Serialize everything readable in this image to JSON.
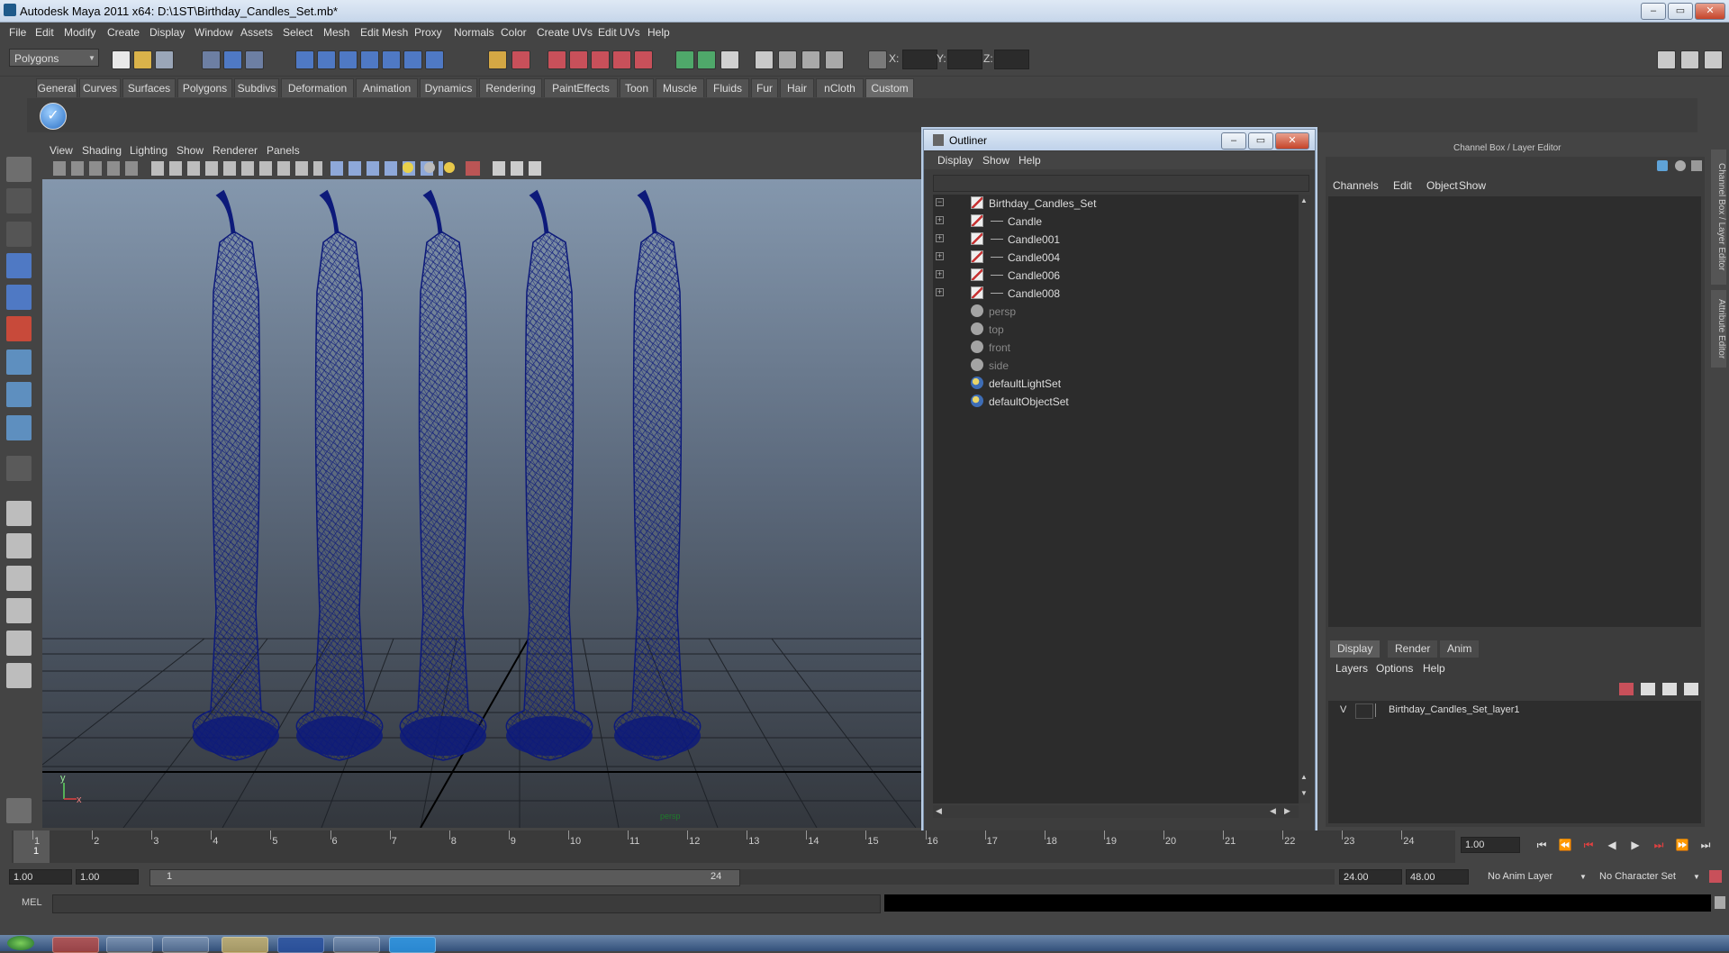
{
  "window": {
    "title": "Autodesk Maya 2011 x64: D:\\1ST\\Birthday_Candles_Set.mb*",
    "min": "‒",
    "max": "▭",
    "close": "✕"
  },
  "menus": [
    "File",
    "Edit",
    "Modify",
    "Create",
    "Display",
    "Window",
    "Assets",
    "Select",
    "Mesh",
    "Edit Mesh",
    "Proxy",
    "Normals",
    "Color",
    "Create UVs",
    "Edit UVs",
    "Help"
  ],
  "statusline": {
    "mode": "Polygons",
    "x_label": "X:",
    "y_label": "Y:",
    "z_label": "Z:"
  },
  "shelf_tabs": [
    "General",
    "Curves",
    "Surfaces",
    "Polygons",
    "Subdivs",
    "Deformation",
    "Animation",
    "Dynamics",
    "Rendering",
    "PaintEffects",
    "Toon",
    "Muscle",
    "Fluids",
    "Fur",
    "Hair",
    "nCloth",
    "Custom"
  ],
  "shelf_active": "Custom",
  "viewport": {
    "menus": [
      "View",
      "Shading",
      "Lighting",
      "Show",
      "Renderer",
      "Panels"
    ],
    "axis_y": "y",
    "axis_x": "x",
    "camera_label": "persp"
  },
  "outliner": {
    "title": "Outliner",
    "menus": [
      "Display",
      "Show",
      "Help"
    ],
    "items": [
      {
        "label": "Birthday_Candles_Set",
        "type": "mesh",
        "expand": "−",
        "indent": 0,
        "dim": false
      },
      {
        "label": "Candle",
        "type": "mesh",
        "expand": "+",
        "indent": 1,
        "dim": false
      },
      {
        "label": "Candle001",
        "type": "mesh",
        "expand": "+",
        "indent": 1,
        "dim": false
      },
      {
        "label": "Candle004",
        "type": "mesh",
        "expand": "+",
        "indent": 1,
        "dim": false
      },
      {
        "label": "Candle006",
        "type": "mesh",
        "expand": "+",
        "indent": 1,
        "dim": false
      },
      {
        "label": "Candle008",
        "type": "mesh",
        "expand": "+",
        "indent": 1,
        "dim": false
      },
      {
        "label": "persp",
        "type": "cam",
        "expand": "",
        "indent": 0,
        "dim": true
      },
      {
        "label": "top",
        "type": "cam",
        "expand": "",
        "indent": 0,
        "dim": true
      },
      {
        "label": "front",
        "type": "cam",
        "expand": "",
        "indent": 0,
        "dim": true
      },
      {
        "label": "side",
        "type": "cam",
        "expand": "",
        "indent": 0,
        "dim": true
      },
      {
        "label": "defaultLightSet",
        "type": "set",
        "expand": "",
        "indent": 0,
        "dim": false
      },
      {
        "label": "defaultObjectSet",
        "type": "set",
        "expand": "",
        "indent": 0,
        "dim": false
      }
    ]
  },
  "channel_box": {
    "title": "Channel Box / Layer Editor",
    "menus": [
      "Channels",
      "Edit",
      "Object",
      "Show"
    ],
    "side_tabs": [
      "Channel Box / Layer Editor",
      "Attribute Editor"
    ]
  },
  "layer_editor": {
    "tabs": [
      "Display",
      "Render",
      "Anim"
    ],
    "active_tab": "Display",
    "menus": [
      "Layers",
      "Options",
      "Help"
    ],
    "layers": [
      {
        "visible": "V",
        "name": "Birthday_Candles_Set_layer1"
      }
    ]
  },
  "timeline": {
    "current_frame": "1",
    "ticks": [
      "1",
      "2",
      "3",
      "4",
      "5",
      "6",
      "7",
      "8",
      "9",
      "10",
      "11",
      "12",
      "13",
      "14",
      "15",
      "16",
      "17",
      "18",
      "19",
      "20",
      "21",
      "22",
      "23",
      "24"
    ],
    "current_time_field": "1.00"
  },
  "range": {
    "start": "1.00",
    "playback_start": "1.00",
    "slider_start": "1",
    "slider_end": "24",
    "playback_end": "24.00",
    "end": "48.00",
    "anim_layer": "No Anim Layer",
    "character_set": "No Character Set"
  },
  "cmdline": {
    "label": "MEL"
  },
  "colors": {
    "wireframe": "#0d1a7a",
    "accent": "#6a6a6a"
  }
}
